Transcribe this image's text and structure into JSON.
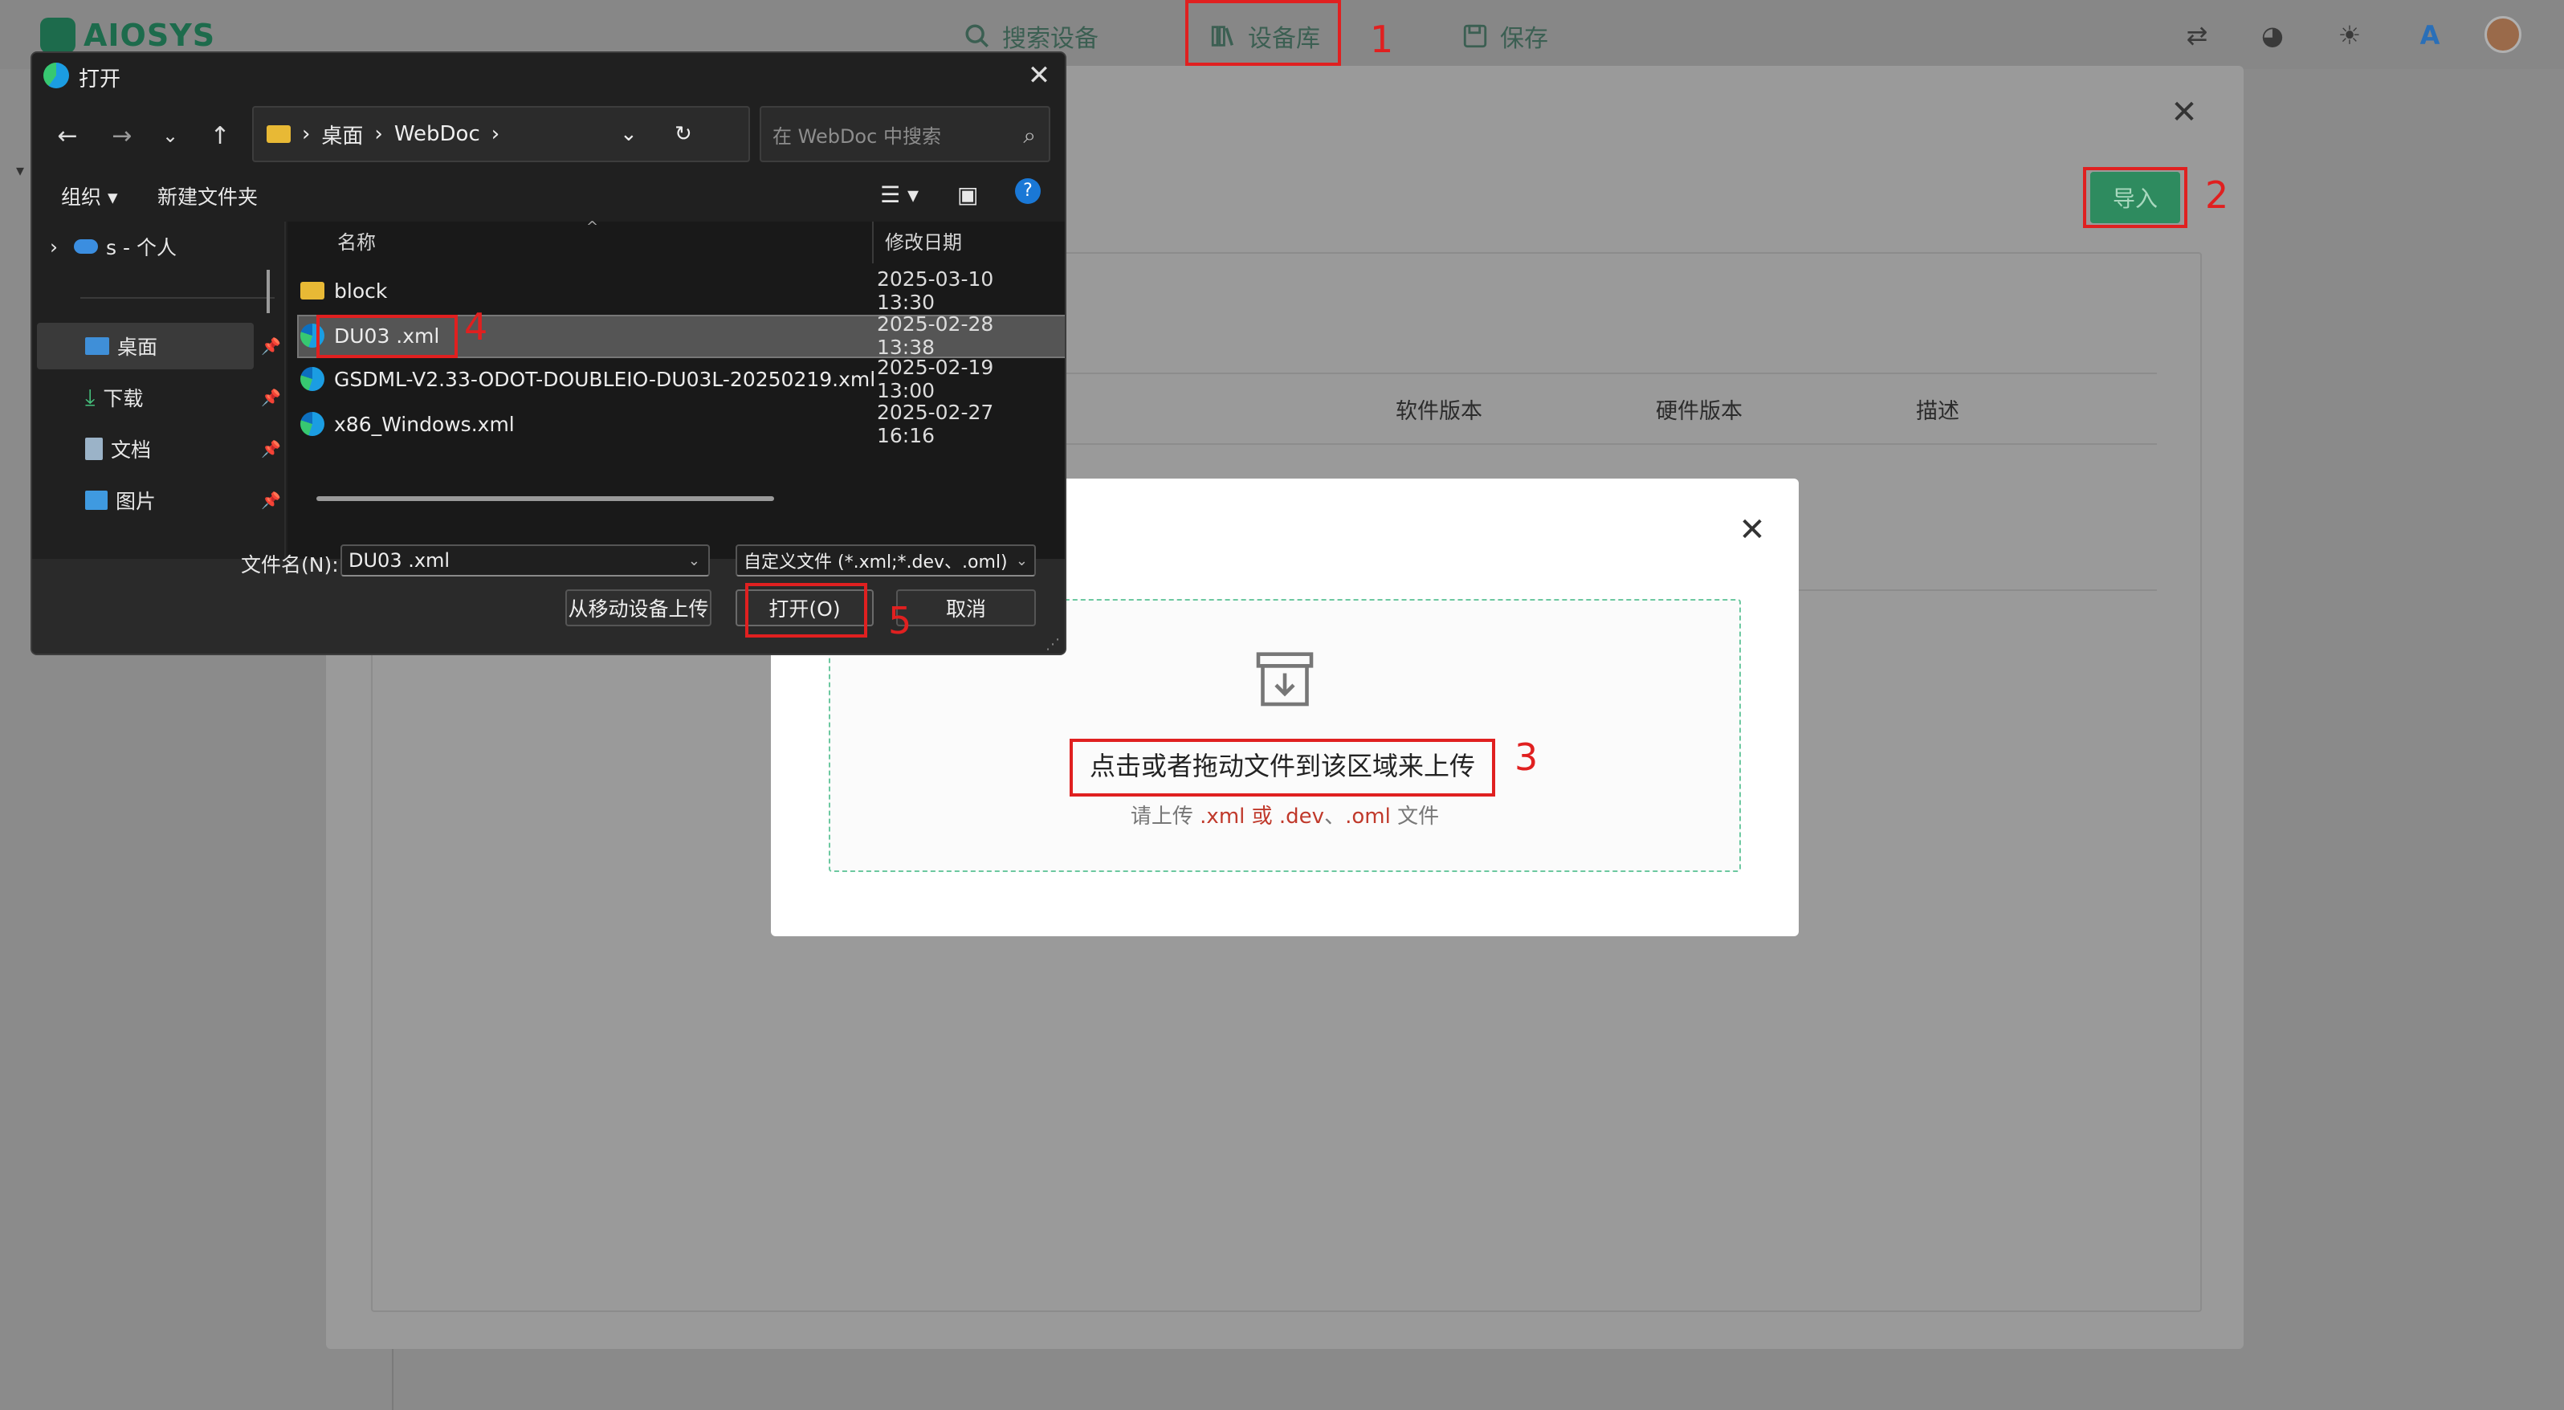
{
  "app": {
    "logo_text": "AIOSYS",
    "nav": [
      {
        "label": "搜索设备",
        "icon": "search-icon"
      },
      {
        "label": "设备库",
        "icon": "library-icon"
      },
      {
        "label": "保存",
        "icon": "save-icon"
      }
    ],
    "header_icons": [
      "translate-icon",
      "palette-icon",
      "sun-icon",
      "font-icon",
      "avatar"
    ],
    "brand_color": "#2e8b5f"
  },
  "device_library": {
    "import_label": "导入",
    "columns": [
      "软件版本",
      "硬件版本",
      "描述"
    ]
  },
  "upload_modal": {
    "title": "点击或者拖动文件到该区域来上传",
    "hint_prefix": "请上传 ",
    "hint_ext1": ".xml",
    "hint_or": " 或 ",
    "hint_ext2": ".dev",
    "hint_sep": "、",
    "hint_ext3": ".oml",
    "hint_suffix": " 文件"
  },
  "file_dialog": {
    "title": "打开",
    "breadcrumb": [
      "桌面",
      "WebDoc"
    ],
    "search_placeholder": "在 WebDoc 中搜索",
    "toolbar": {
      "organize": "组织",
      "new_folder": "新建文件夹"
    },
    "sidebar": [
      {
        "label": "s - 个人",
        "icon": "cloud-icon"
      },
      {
        "label": "桌面",
        "icon": "desktop-icon"
      },
      {
        "label": "下载",
        "icon": "download-icon"
      },
      {
        "label": "文档",
        "icon": "document-icon"
      },
      {
        "label": "图片",
        "icon": "picture-icon"
      }
    ],
    "columns": {
      "name": "名称",
      "modified": "修改日期"
    },
    "files": [
      {
        "name": "block",
        "date": "2025-03-10 13:30",
        "type": "folder"
      },
      {
        "name": "DU03 .xml",
        "date": "2025-02-28 13:38",
        "type": "xml",
        "selected": true
      },
      {
        "name": "GSDML-V2.33-ODOT-DOUBLEIO-DU03L-20250219.xml",
        "date": "2025-02-19 13:00",
        "type": "xml"
      },
      {
        "name": "x86_Windows.xml",
        "date": "2025-02-27 16:16",
        "type": "xml"
      }
    ],
    "filename_label": "文件名(N):",
    "filename_value": "DU03 .xml",
    "filetype_value": "自定义文件 (*.xml;*.dev、.oml)",
    "upload_mobile": "从移动设备上传",
    "open_btn": "打开(O)",
    "cancel_btn": "取消"
  },
  "annotations": [
    "1",
    "2",
    "3",
    "4",
    "5"
  ]
}
